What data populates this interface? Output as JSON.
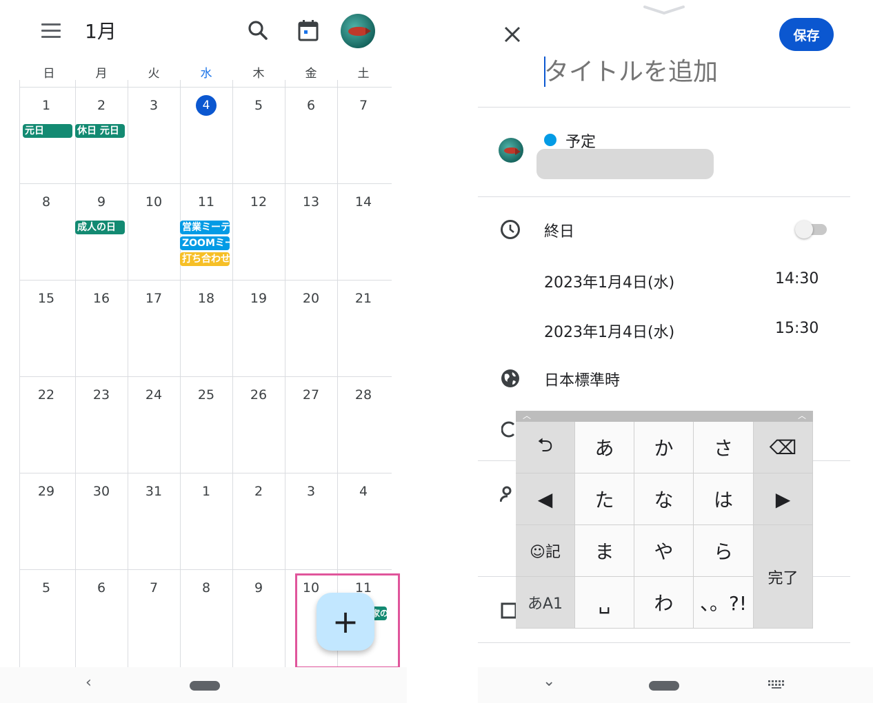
{
  "calendar": {
    "month_title": "1月",
    "weekdays": [
      "日",
      "月",
      "火",
      "水",
      "木",
      "金",
      "土"
    ],
    "today_weekday_index": 3,
    "weeks": [
      [
        "1",
        "2",
        "3",
        "4",
        "5",
        "6",
        "7"
      ],
      [
        "8",
        "9",
        "10",
        "11",
        "12",
        "13",
        "14"
      ],
      [
        "15",
        "16",
        "17",
        "18",
        "19",
        "20",
        "21"
      ],
      [
        "22",
        "23",
        "24",
        "25",
        "26",
        "27",
        "28"
      ],
      [
        "29",
        "30",
        "31",
        "1",
        "2",
        "3",
        "4"
      ],
      [
        "5",
        "6",
        "7",
        "8",
        "9",
        "10",
        "11"
      ]
    ],
    "today_date": "4",
    "events": {
      "jan1": "元日",
      "jan2": "休日 元日",
      "jan9": "成人の日",
      "jan11_a": "営業ミーテ",
      "jan11_b": "ZOOMミー",
      "jan11_c": "打ち合わせ",
      "feb11": "家の"
    },
    "event_colors": {
      "holiday": "#138a72",
      "blue": "#039be5",
      "yellow": "#f6bf26"
    },
    "fab_icon": "plus-icon",
    "fab_label": "+"
  },
  "editor": {
    "save_label": "保存",
    "title_placeholder": "タイトルを追加",
    "calendar_name": "予定",
    "all_day_label": "終日",
    "all_day_enabled": false,
    "start_date": "2023年1月4日(水)",
    "start_time": "14:30",
    "end_date": "2023年1月4日(水)",
    "end_time": "15:30",
    "timezone": "日本標準時",
    "accent_color": "#0b57d0"
  },
  "keyboard": {
    "rows": [
      [
        "⮌",
        "あ",
        "か",
        "さ",
        "⌫"
      ],
      [
        "◀",
        "た",
        "な",
        "は",
        "▶"
      ],
      [
        "☺記",
        "ま",
        "や",
        "ら"
      ],
      [
        "あA1",
        "␣",
        "わ",
        "、。?!"
      ]
    ],
    "done_label": "完了"
  },
  "system_nav": {
    "back_glyph": "‹",
    "down_glyph": "⌄"
  }
}
